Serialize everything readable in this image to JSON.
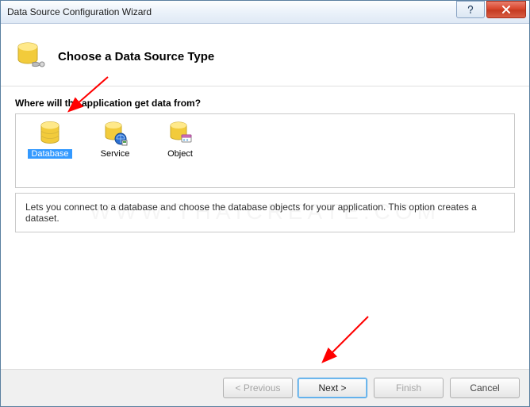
{
  "window": {
    "title": "Data Source Configuration Wizard"
  },
  "header": {
    "title": "Choose a Data Source Type"
  },
  "question": "Where will the application get data from?",
  "options": {
    "database": "Database",
    "service": "Service",
    "object": "Object"
  },
  "description": "Lets you connect to a database and choose the database objects for your application. This option creates a dataset.",
  "buttons": {
    "previous": "< Previous",
    "next": "Next >",
    "finish": "Finish",
    "cancel": "Cancel"
  },
  "watermark": "WWW.THAICREATE.COM"
}
